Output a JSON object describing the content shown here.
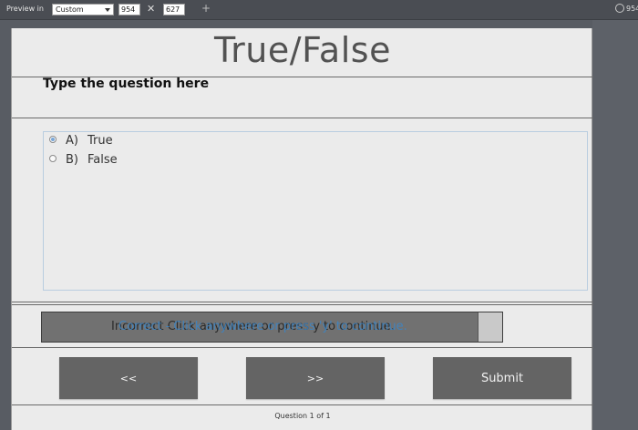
{
  "toolbar": {
    "preview_label": "Preview in",
    "device_select": "Custom",
    "width_value": "954",
    "height_value": "627",
    "separator": "✕",
    "add_symbol": "+",
    "right_value": "954"
  },
  "slide": {
    "title": "True/False",
    "question": "Type the question here",
    "choices": [
      {
        "letter": "A)",
        "label": "True",
        "selected": true
      },
      {
        "letter": "B)",
        "label": "False",
        "selected": false
      }
    ],
    "feedback": {
      "text_overlay_a": "Incorrect Click anywhere or press y to continue.",
      "text_overlay_b": "Correct - Click anywhere or press 'y' to continue."
    },
    "buttons": {
      "prev": "<<",
      "next": ">>",
      "submit": "Submit"
    },
    "counter": "Question 1 of 1"
  },
  "colors": {
    "background": "#585c63",
    "slide": "#ebebeb",
    "button": "#646464",
    "accent": "#3a86c8"
  }
}
